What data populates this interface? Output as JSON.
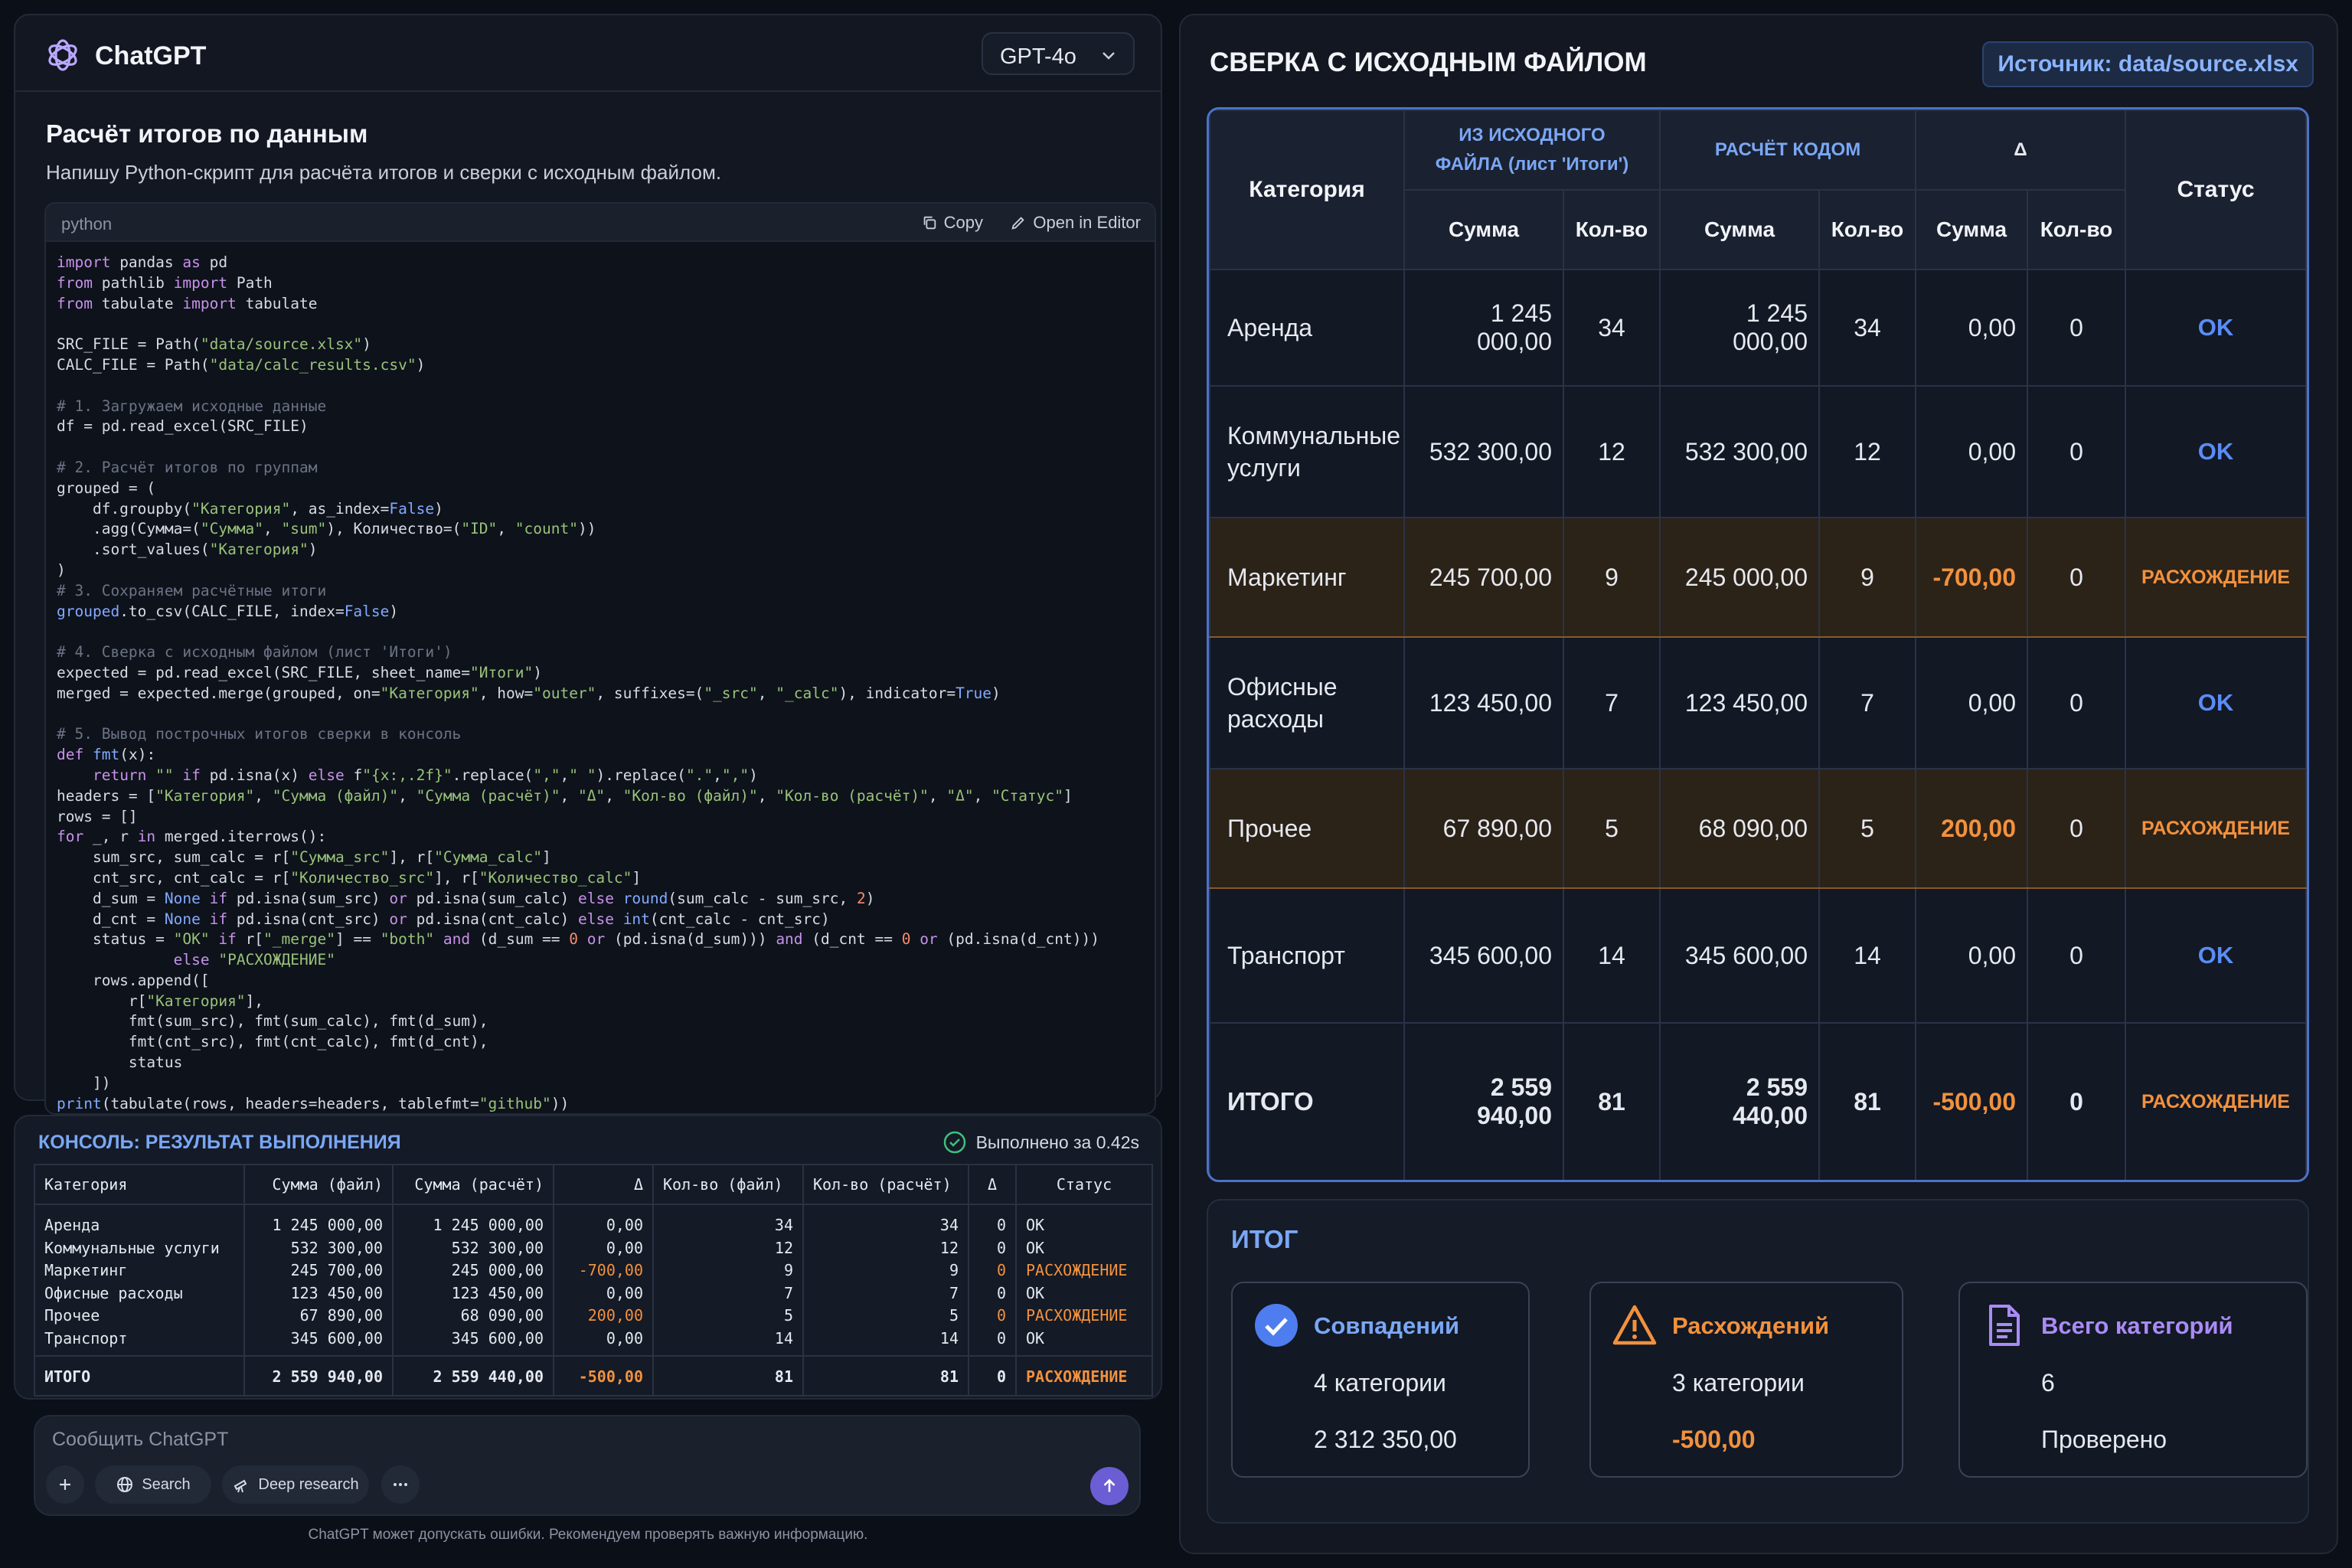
{
  "app": {
    "title": "ChatGPT",
    "model": "GPT-4o"
  },
  "message": {
    "title": "Расчёт итогов по данным",
    "subtitle": "Напишу Python-скрипт для расчёта итогов и сверки с исходным файлом."
  },
  "code": {
    "language": "python",
    "copy_label": "Copy",
    "editor_label": "Open in Editor"
  },
  "console": {
    "title": "КОНСОЛЬ: РЕЗУЛЬТАТ ВЫПОЛНЕНИЯ",
    "status": "Выполнено за 0.42s",
    "headers": [
      "Категория",
      "Сумма (файл)",
      "Сумма (расчёт)",
      "Δ",
      "Кол-во (файл)",
      "Кол-во (расчёт)",
      "Δ",
      "Статус"
    ],
    "rows": [
      [
        "Аренда",
        "1 245 000,00",
        "1 245 000,00",
        "0,00",
        "34",
        "34",
        "0",
        "OK"
      ],
      [
        "Коммунальные услуги",
        "532 300,00",
        "532 300,00",
        "0,00",
        "12",
        "12",
        "0",
        "OK"
      ],
      [
        "Маркетинг",
        "245 700,00",
        "245 000,00",
        "-700,00",
        "9",
        "9",
        "0",
        "РАСХОЖДЕНИЕ"
      ],
      [
        "Офисные расходы",
        "123 450,00",
        "123 450,00",
        "0,00",
        "7",
        "7",
        "0",
        "OK"
      ],
      [
        "Прочее",
        "67 890,00",
        "68 090,00",
        "200,00",
        "5",
        "5",
        "0",
        "РАСХОЖДЕНИЕ"
      ],
      [
        "Транспорт",
        "345 600,00",
        "345 600,00",
        "0,00",
        "14",
        "14",
        "0",
        "OK"
      ]
    ],
    "total": [
      "ИТОГО",
      "2 559 940,00",
      "2 559 440,00",
      "-500,00",
      "81",
      "81",
      "0",
      "РАСХОЖДЕНИЕ"
    ]
  },
  "composer": {
    "placeholder": "Сообщить ChatGPT",
    "search_label": "Search",
    "research_label": "Deep research",
    "disclaimer": "ChatGPT может допускать ошибки. Рекомендуем проверять важную информацию."
  },
  "recon": {
    "title": "СВЕРКА С ИСХОДНЫМ ФАЙЛОМ",
    "source_badge": "Источник: data/source.xlsx",
    "col_category": "Категория",
    "group_file": "ИЗ ИСХОДНОГО ФАЙЛА (лист 'Итоги')",
    "group_code": "РАСЧЁТ КОДОМ",
    "group_delta": "Δ",
    "col_status": "Статус",
    "sub_sum": "Сумма",
    "sub_count": "Кол-во",
    "rows": [
      {
        "category": "Аренда",
        "sum_file": "1 245 000,00",
        "cnt_file": "34",
        "sum_calc": "1 245 000,00",
        "cnt_calc": "34",
        "d_sum": "0,00",
        "d_cnt": "0",
        "status": "OK",
        "mismatch": false
      },
      {
        "category": "Коммунальные услуги",
        "sum_file": "532 300,00",
        "cnt_file": "12",
        "sum_calc": "532 300,00",
        "cnt_calc": "12",
        "d_sum": "0,00",
        "d_cnt": "0",
        "status": "OK",
        "mismatch": false
      },
      {
        "category": "Маркетинг",
        "sum_file": "245 700,00",
        "cnt_file": "9",
        "sum_calc": "245 000,00",
        "cnt_calc": "9",
        "d_sum": "-700,00",
        "d_cnt": "0",
        "status": "РАСХОЖДЕНИЕ",
        "mismatch": true
      },
      {
        "category": "Офисные расходы",
        "sum_file": "123 450,00",
        "cnt_file": "7",
        "sum_calc": "123 450,00",
        "cnt_calc": "7",
        "d_sum": "0,00",
        "d_cnt": "0",
        "status": "OK",
        "mismatch": false
      },
      {
        "category": "Прочее",
        "sum_file": "67 890,00",
        "cnt_file": "5",
        "sum_calc": "68 090,00",
        "cnt_calc": "5",
        "d_sum": "200,00",
        "d_cnt": "0",
        "status": "РАСХОЖДЕНИЕ",
        "mismatch": true
      },
      {
        "category": "Транспорт",
        "sum_file": "345 600,00",
        "cnt_file": "14",
        "sum_calc": "345 600,00",
        "cnt_calc": "14",
        "d_sum": "0,00",
        "d_cnt": "0",
        "status": "OK",
        "mismatch": false
      }
    ],
    "total": {
      "category": "ИТОГО",
      "sum_file": "2 559 940,00",
      "cnt_file": "81",
      "sum_calc": "2 559 440,00",
      "cnt_calc": "81",
      "d_sum": "-500,00",
      "d_cnt": "0",
      "status": "РАСХОЖДЕНИЕ"
    }
  },
  "summary": {
    "title": "ИТОГ",
    "matches": {
      "title": "Совпадений",
      "line1": "4 категории",
      "line2": "2 312 350,00"
    },
    "mismatches": {
      "title": "Расхождений",
      "line1": "3 категории",
      "line2": "-500,00"
    },
    "total": {
      "title": "Всего категорий",
      "line1": "6",
      "line2": "Проверено"
    }
  },
  "colors": {
    "accent_blue": "#7aa7f5",
    "ok_blue": "#5b8cf6",
    "warn_orange": "#f2913d",
    "purple": "#a98bf5",
    "success_green": "#3fbf7f"
  }
}
